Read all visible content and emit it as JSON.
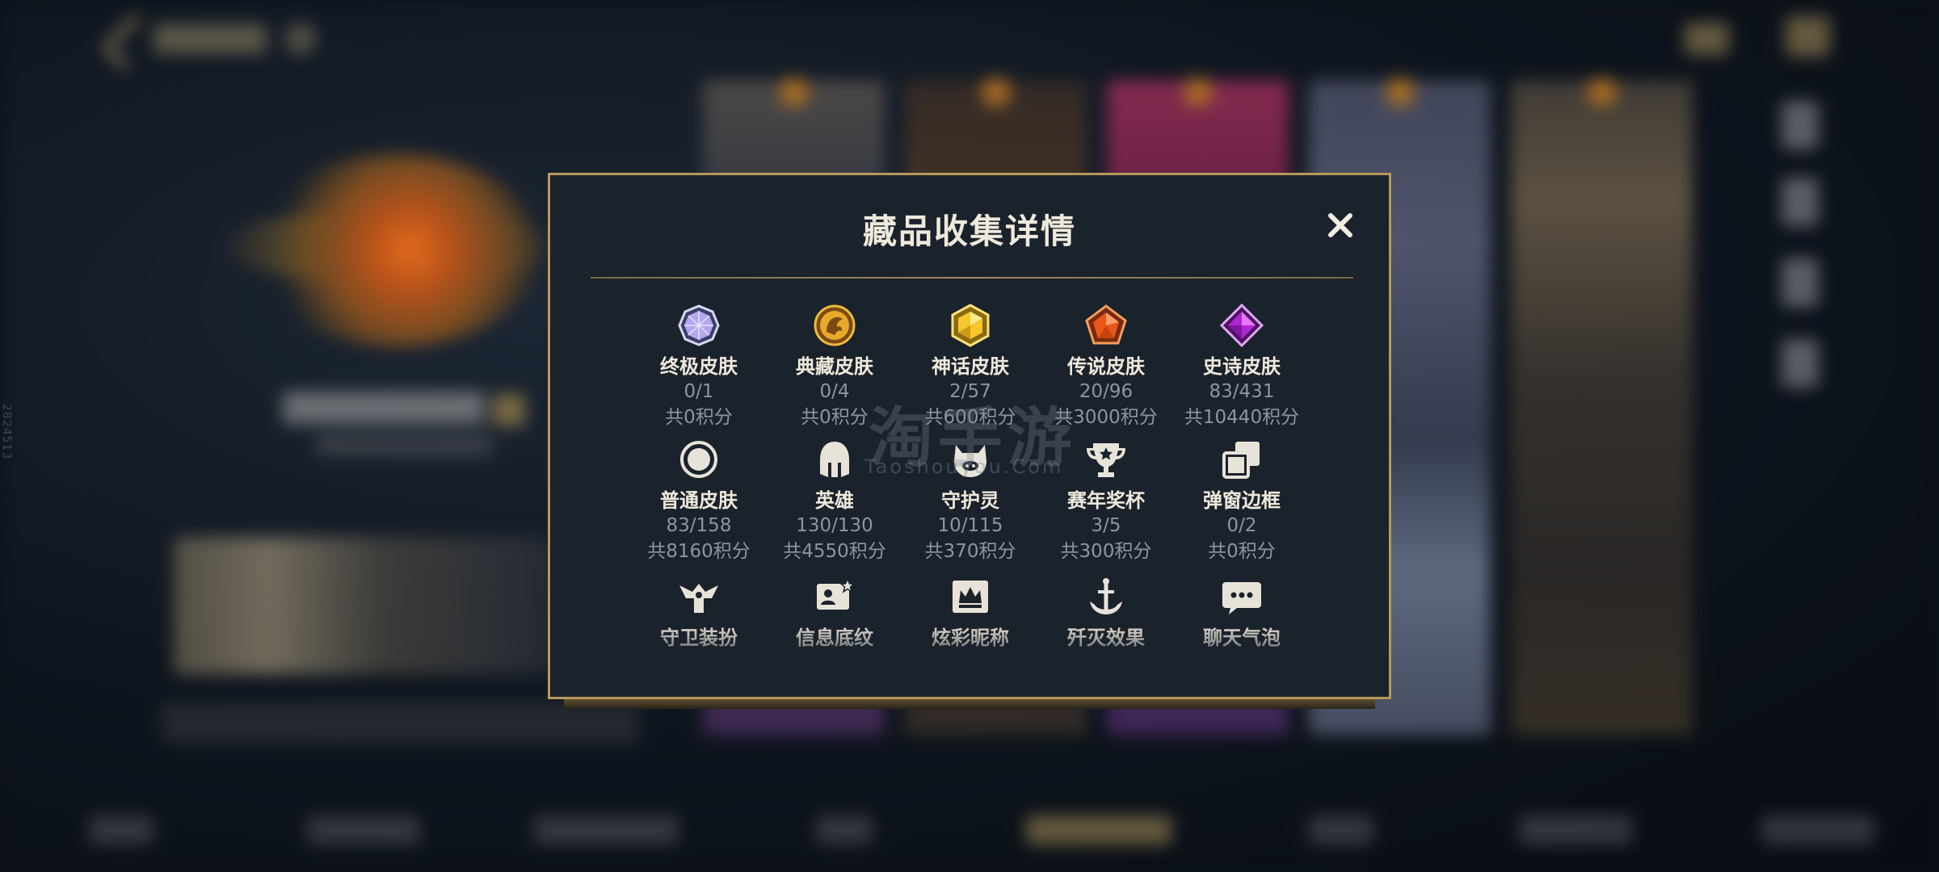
{
  "dialog": {
    "title": "藏品收集详情"
  },
  "watermark": {
    "cn": "淘手游",
    "en": "Taoshouyou.Com"
  },
  "side_id": "2824513",
  "colors": {
    "accent_gold": "#b8985a",
    "dialog_bg": "#1a222c",
    "text_primary": "#efe9dc",
    "text_secondary": "#8d96a0"
  },
  "items": [
    {
      "label": "终极皮肤",
      "count": "0/1",
      "points": "共0积分",
      "icon": "ultimate-skin-gem-icon"
    },
    {
      "label": "典藏皮肤",
      "count": "0/4",
      "points": "共0积分",
      "icon": "collection-skin-dragon-icon"
    },
    {
      "label": "神话皮肤",
      "count": "2/57",
      "points": "共600积分",
      "icon": "myth-skin-gem-icon"
    },
    {
      "label": "传说皮肤",
      "count": "20/96",
      "points": "共3000积分",
      "icon": "legend-skin-gem-icon"
    },
    {
      "label": "史诗皮肤",
      "count": "83/431",
      "points": "共10440积分",
      "icon": "epic-skin-gem-icon"
    },
    {
      "label": "普通皮肤",
      "count": "83/158",
      "points": "共8160积分",
      "icon": "normal-skin-circle-icon"
    },
    {
      "label": "英雄",
      "count": "130/130",
      "points": "共4550积分",
      "icon": "hero-helmet-icon"
    },
    {
      "label": "守护灵",
      "count": "10/115",
      "points": "共370积分",
      "icon": "guardian-spirit-icon"
    },
    {
      "label": "赛年奖杯",
      "count": "3/5",
      "points": "共300积分",
      "icon": "season-trophy-icon"
    },
    {
      "label": "弹窗边框",
      "count": "0/2",
      "points": "共0积分",
      "icon": "popup-frame-icon"
    },
    {
      "label": "守卫装扮",
      "count": "",
      "points": "",
      "icon": "guard-outfit-icon"
    },
    {
      "label": "信息底纹",
      "count": "",
      "points": "",
      "icon": "info-background-icon"
    },
    {
      "label": "炫彩昵称",
      "count": "",
      "points": "",
      "icon": "colorful-nickname-icon"
    },
    {
      "label": "歼灭效果",
      "count": "",
      "points": "",
      "icon": "annihilation-effect-icon"
    },
    {
      "label": "聊天气泡",
      "count": "",
      "points": "",
      "icon": "chat-bubble-icon"
    }
  ]
}
